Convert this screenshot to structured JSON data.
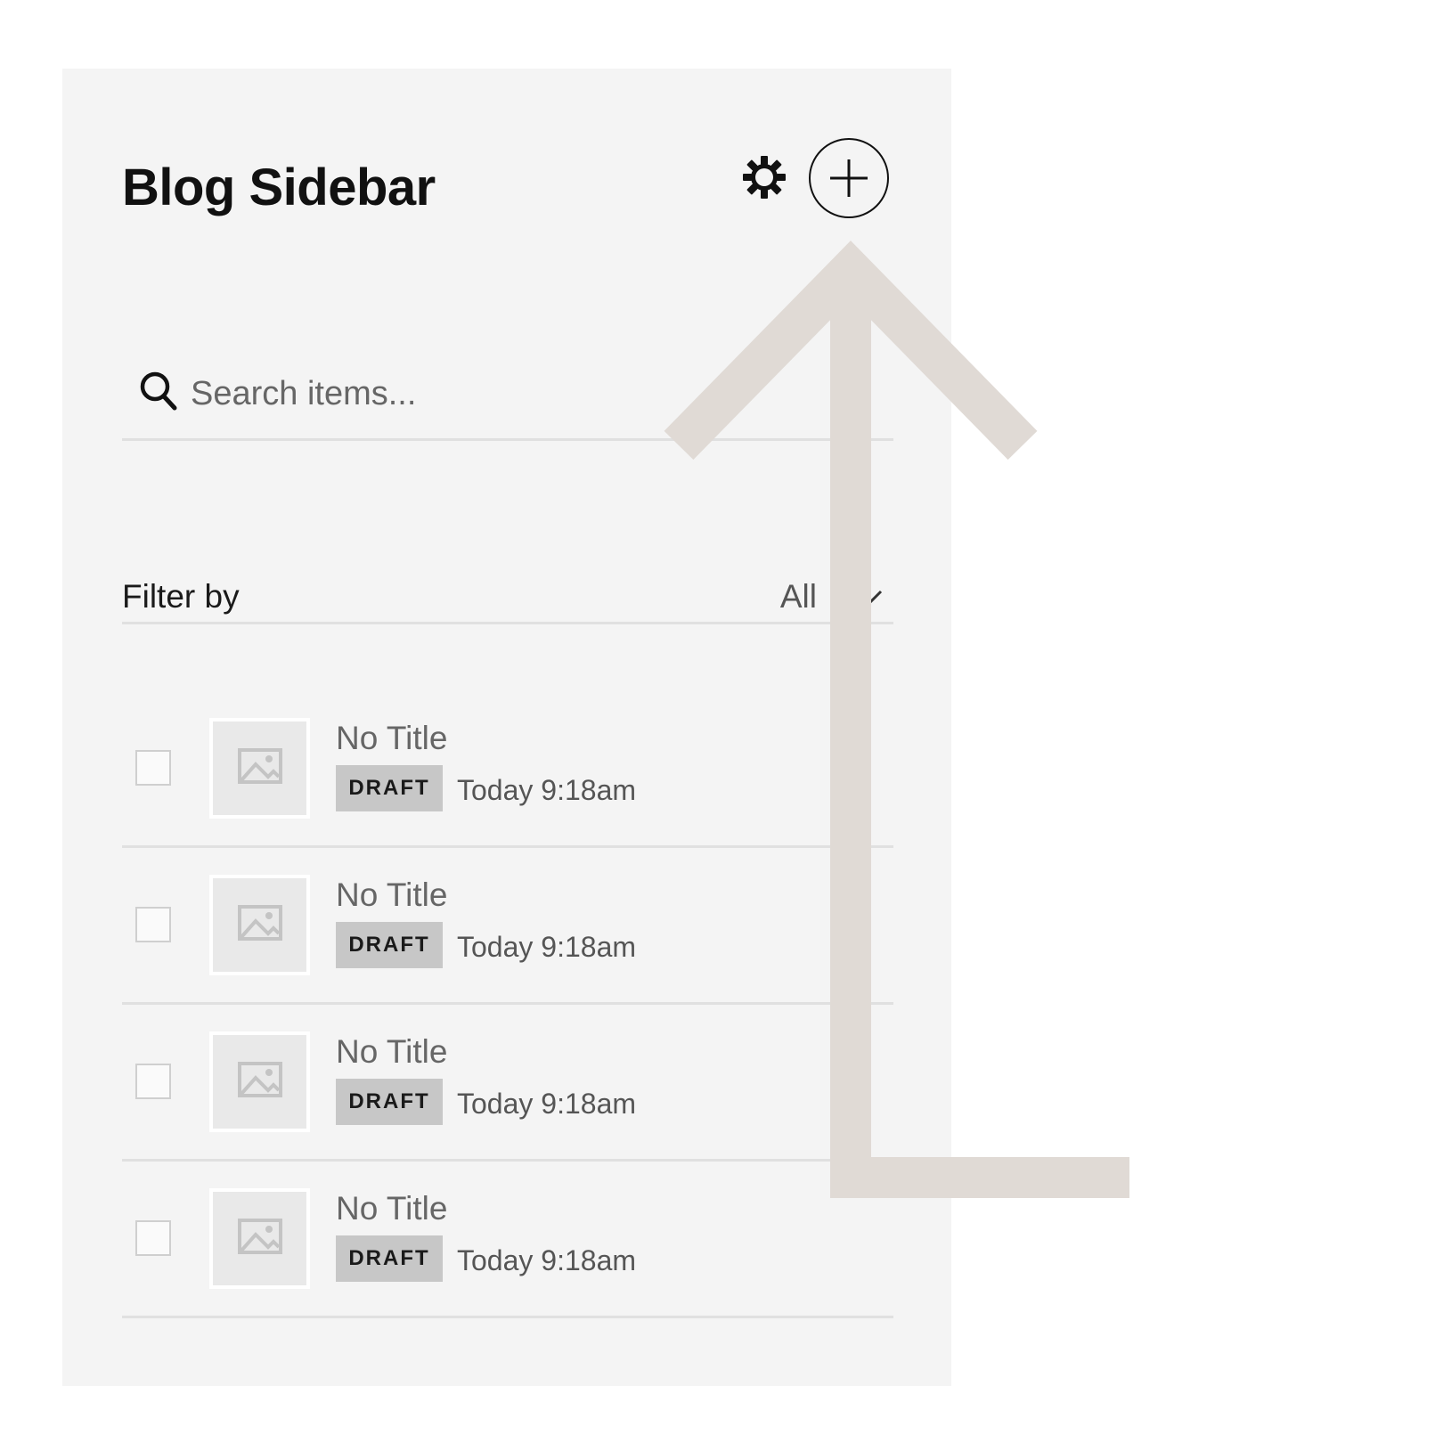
{
  "sidebar": {
    "title": "Blog Sidebar",
    "icons": {
      "settings": "gear-icon",
      "add": "plus-icon"
    }
  },
  "search": {
    "placeholder": "Search items...",
    "value": ""
  },
  "filter": {
    "label": "Filter by",
    "value": "All"
  },
  "items": [
    {
      "title": "No Title",
      "status": "DRAFT",
      "date": "Today 9:18am"
    },
    {
      "title": "No Title",
      "status": "DRAFT",
      "date": "Today 9:18am"
    },
    {
      "title": "No Title",
      "status": "DRAFT",
      "date": "Today 9:18am"
    },
    {
      "title": "No Title",
      "status": "DRAFT",
      "date": "Today 9:18am"
    }
  ],
  "colors": {
    "panel_bg": "#f4f4f4",
    "badge_bg": "#c7c7c7",
    "arrow": "#e0dad5",
    "text": "#111111"
  }
}
